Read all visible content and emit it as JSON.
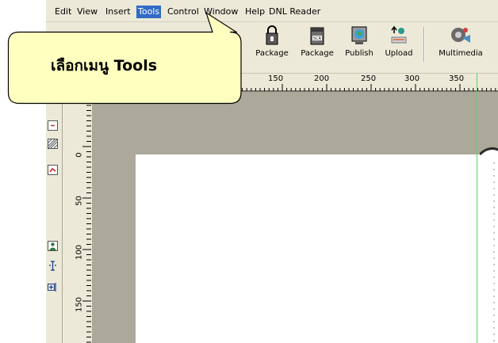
{
  "menu": {
    "items": [
      "Edit",
      "View",
      "Insert",
      "Tools",
      "Control",
      "Window",
      "Help",
      "DNL Reader"
    ],
    "active": "Tools",
    "active_color": "#316ac5"
  },
  "toolbar": {
    "buttons": [
      {
        "label": "Package",
        "icon": "lock-package-icon"
      },
      {
        "label": "Package",
        "icon": "scorm-package-icon"
      },
      {
        "label": "Publish",
        "icon": "publish-globe-icon"
      },
      {
        "label": "Upload",
        "icon": "upload-icon"
      },
      {
        "label": "Multimedia",
        "icon": "multimedia-icon"
      }
    ]
  },
  "ruler": {
    "horizontal_ticks": [
      "150",
      "200",
      "250",
      "300",
      "350"
    ],
    "vertical_ticks": [
      "0",
      "50",
      "100",
      "150"
    ]
  },
  "callout": {
    "text": "เลือกเมนู Tools",
    "fill_color": "#ffffc0",
    "border_color": "#000000"
  },
  "guide_color": "#62d65a"
}
